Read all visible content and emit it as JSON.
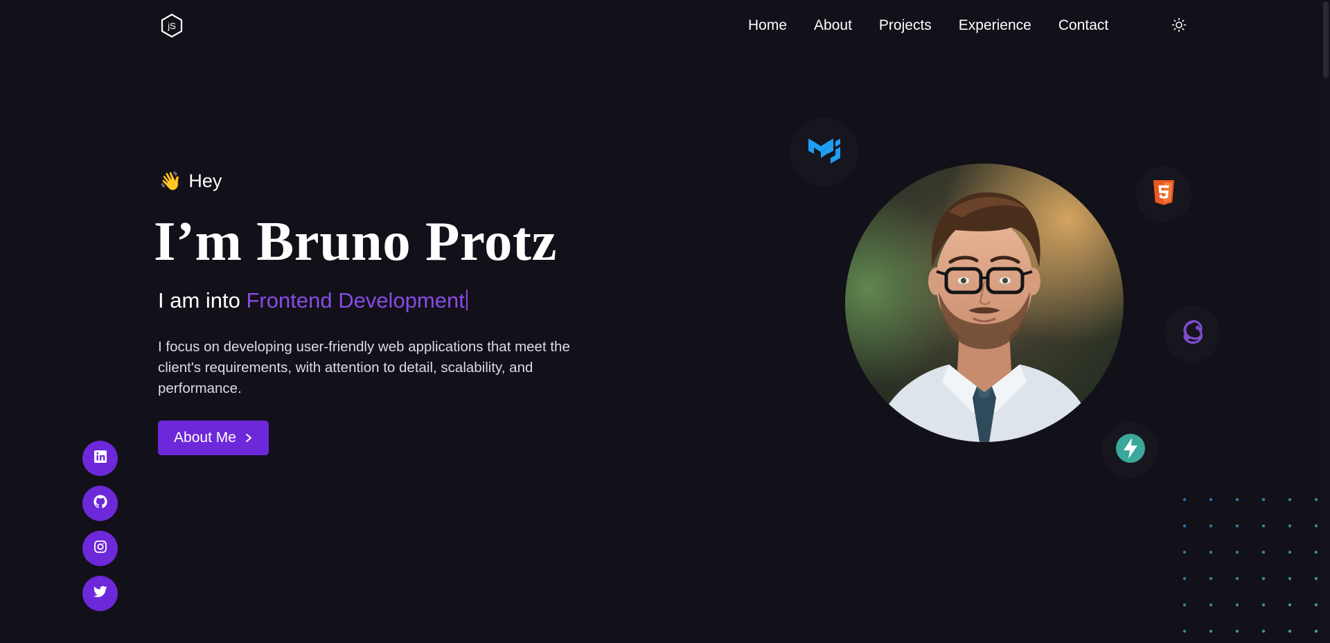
{
  "header": {
    "nav": [
      {
        "label": "Home"
      },
      {
        "label": "About"
      },
      {
        "label": "Projects"
      },
      {
        "label": "Experience"
      },
      {
        "label": "Contact"
      }
    ]
  },
  "hero": {
    "greeting_emoji": "👋",
    "greeting": "Hey",
    "title": "I’m Bruno Protz",
    "tagline_prefix": "I am into ",
    "tagline_accent": "Frontend Development",
    "description": "I focus on developing user-friendly web applications that meet the client's requirements, with attention to detail, scalability, and performance.",
    "cta_label": "About Me"
  },
  "socials": [
    {
      "icon": "linkedin-icon"
    },
    {
      "icon": "github-icon"
    },
    {
      "icon": "instagram-icon"
    },
    {
      "icon": "twitter-icon"
    }
  ],
  "tech_badges": [
    {
      "icon": "material-ui-icon",
      "color": "#1e9df2"
    },
    {
      "icon": "html5-icon",
      "color": "#e8591f"
    },
    {
      "icon": "redux-icon",
      "color": "#7c4dcc"
    },
    {
      "icon": "supabase-icon",
      "color": "#3ecf8e"
    }
  ],
  "colors": {
    "background": "#121018",
    "accent": "#6d28d9",
    "accent_text": "#8a4be8"
  }
}
